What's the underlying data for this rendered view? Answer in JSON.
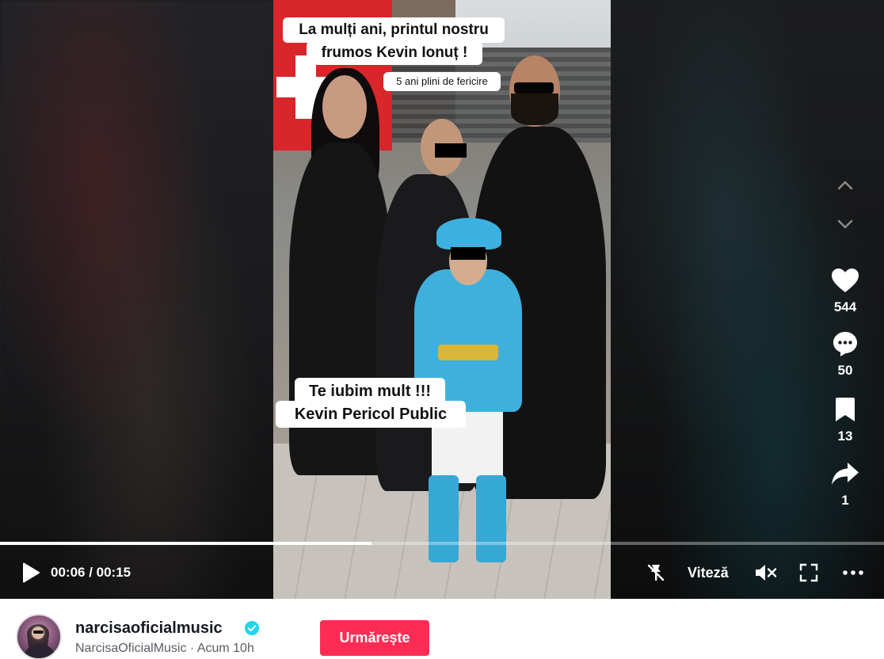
{
  "video": {
    "caption_top_line1": "La mulți ani, printul nostru",
    "caption_top_line2": "frumos Kevin Ionuț !",
    "caption_small": "5 ani plini de fericire",
    "caption_mid_line1": "Te iubim mult !!!",
    "caption_mid_line2": "Kevin Pericol Public"
  },
  "actions": {
    "likes": "544",
    "comments": "50",
    "saves": "13",
    "shares": "1"
  },
  "player": {
    "time": "00:06 / 00:15",
    "progress_fraction": 0.42,
    "speed_label": "Viteză"
  },
  "author": {
    "username": "narcisaoficialmusic",
    "display_name": "NarcisaOficialMusic",
    "separator": "·",
    "posted": "Acum 10h",
    "follow_label": "Urmărește"
  },
  "colors": {
    "accent": "#fe2c55",
    "verified": "#20d5ec"
  }
}
